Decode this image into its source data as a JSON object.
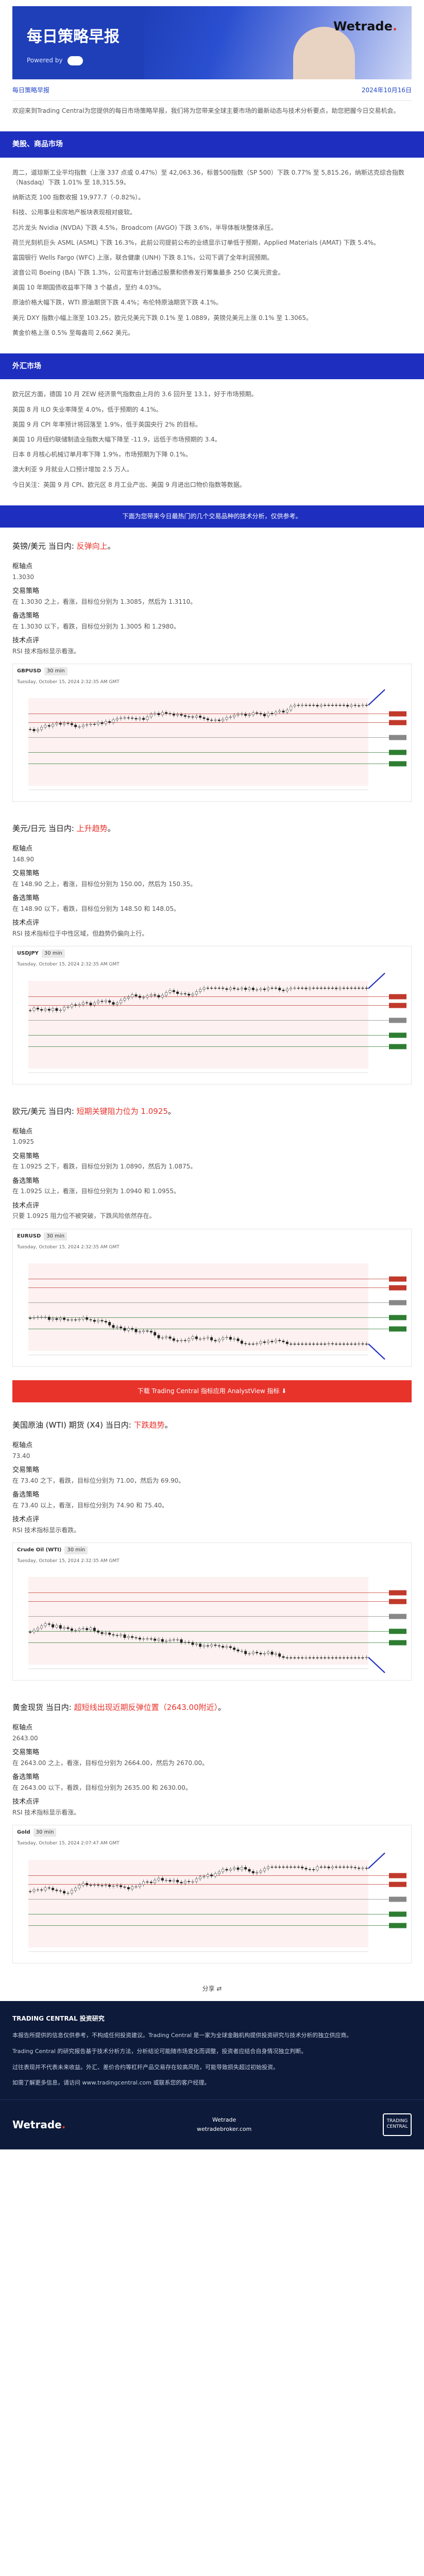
{
  "banner": {
    "title": "每日策略早报",
    "powered": "Powered by",
    "logo_main": "Wetrade",
    "logo_dot": "."
  },
  "meta": {
    "left": "每日策略早报",
    "right": "2024年10月16日"
  },
  "intro": "欢迎来到Trading Central为您提供的每日市场策略早报，我们将为您带来全球主要市场的最新动态与技术分析要点，助您把握今日交易机会。",
  "sections": {
    "stocks": "美股、商品市场",
    "fx": "外汇市场",
    "fx_intro_bar": "下面为您带来今日最热门的几个交易品种的技术分析，仅供参考。"
  },
  "stock_paras": [
    "周二，道琼斯工业平均指数（上涨 337 点或 0.47%）至 42,063.36，标普500指数（SP 500）下跌 0.77% 至 5,815.26，纳斯达克综合指数（Nasdaq）下跌 1.01% 至 18,315.59。",
    "纳斯达克 100 指数收报 19,977.7（-0.82%）。",
    "科技、公用事业和房地产板块表现相对疲软。",
    "芯片龙头 Nvidia (NVDA) 下跌 4.5%，Broadcom (AVGO) 下跌 3.6%，半导体板块整体承压。",
    "荷兰光刻机巨头 ASML (ASML) 下跌 16.3%，此前公司提前公布的业绩显示订单低于预期，Applied Materials (AMAT) 下跌 5.4%。",
    "富国银行 Wells Fargo (WFC) 上涨，联合健康 (UNH) 下跌 8.1%，公司下调了全年利润预期。",
    "波音公司 Boeing (BA) 下跌 1.3%，公司宣布计划通过股票和债券发行筹集最多 250 亿美元资金。",
    "美国 10 年期国债收益率下降 3 个基点，至约 4.03%。",
    "原油价格大幅下跌，WTI 原油期货下跌 4.4%；布伦特原油期货下跌 4.1%。",
    "美元 DXY 指数小幅上涨至 103.25，欧元兑美元下跌 0.1% 至 1.0889，英镑兑美元上涨 0.1% 至 1.3065。",
    "黄金价格上涨 0.5% 至每盎司 2,662 美元。"
  ],
  "fx_paras": [
    "欧元区方面，德国 10 月 ZEW 经济景气指数由上月的 3.6 回升至 13.1，好于市场预期。",
    "英国 8 月 ILO 失业率降至 4.0%，低于预期的 4.1%。",
    "英国 9 月 CPI 年率预计将回落至 1.9%，低于英国央行 2% 的目标。",
    "美国 10 月纽约联储制造业指数大幅下降至 -11.9，远低于市场预期的 3.4。",
    "日本 8 月核心机械订单月率下降 1.9%，市场预期为下降 0.1%。",
    "澳大利亚 9 月就业人口预计增加 2.5 万人。",
    "今日关注：英国 9 月 CPI、欧元区 8 月工业产出、美国 9 月进出口物价指数等数据。"
  ],
  "instruments": [
    {
      "name": "英镑/美元",
      "trend": "反弹向上",
      "pivot_label": "枢轴点",
      "pivot": "1.3030",
      "strategy_label": "交易策略",
      "strategy": "在 1.3030 之上，看涨，目标位分别为 1.3085，然后为 1.3110。",
      "alt_label": "备选策略",
      "alt": "在 1.3030 以下，看跌，目标位分别为 1.3005 和 1.2980。",
      "tech_label": "技术点评",
      "tech": "RSI 技术指标显示看涨。",
      "chart": {
        "symbol": "GBPUSD",
        "timeframe": "30 min",
        "sub": "Tuesday, October 15, 2024 2:32:35 AM GMT",
        "trend_dir": "up"
      }
    },
    {
      "name": "美元/日元",
      "trend": "上升趋势",
      "pivot_label": "枢轴点",
      "pivot": "148.90",
      "strategy_label": "交易策略",
      "strategy": "在 148.90 之上，看涨，目标位分别为 150.00，然后为 150.35。",
      "alt_label": "备选策略",
      "alt": "在 148.90 以下，看跌，目标位分别为 148.50 和 148.05。",
      "tech_label": "技术点评",
      "tech": "RSI 技术指标位于中性区域，但趋势仍偏向上行。",
      "chart": {
        "symbol": "USDJPY",
        "timeframe": "30 min",
        "sub": "Tuesday, October 15, 2024 2:32:35 AM GMT",
        "trend_dir": "up"
      }
    },
    {
      "name": "欧元/美元",
      "trend": "短期关键阻力位为 1.0925",
      "pivot_label": "枢轴点",
      "pivot": "1.0925",
      "strategy_label": "交易策略",
      "strategy": "在 1.0925 之下，看跌，目标位分别为 1.0890，然后为 1.0875。",
      "alt_label": "备选策略",
      "alt": "在 1.0925 以上，看涨，目标位分别为 1.0940 和 1.0955。",
      "tech_label": "技术点评",
      "tech": "只要 1.0925 阻力位不被突破，下跌风险依然存在。",
      "chart": {
        "symbol": "EURUSD",
        "timeframe": "30 min",
        "sub": "Tuesday, October 15, 2024 2:32:35 AM GMT",
        "trend_dir": "down"
      }
    }
  ],
  "cta": "下载 Trading Central 指标应用 AnalystView 指标 ⬇",
  "instruments2": [
    {
      "name": "美国原油 (WTI) 期货 (X4)",
      "trend": "下跌趋势",
      "pivot_label": "枢轴点",
      "pivot": "73.40",
      "strategy_label": "交易策略",
      "strategy": "在 73.40 之下，看跌，目标位分别为 71.00，然后为 69.90。",
      "alt_label": "备选策略",
      "alt": "在 73.40 以上，看涨，目标位分别为 74.90 和 75.40。",
      "tech_label": "技术点评",
      "tech": "RSI 技术指标显示看跌。",
      "chart": {
        "symbol": "Crude Oil (WTI)",
        "timeframe": "30 min",
        "sub": "Tuesday, October 15, 2024 2:32:35 AM GMT",
        "trend_dir": "down"
      }
    },
    {
      "name": "黄金现货",
      "trend": "超短线出现近期反弹位置（2643.00附近）",
      "pivot_label": "枢轴点",
      "pivot": "2643.00",
      "strategy_label": "交易策略",
      "strategy": "在 2643.00 之上，看涨，目标位分别为 2664.00，然后为 2670.00。",
      "alt_label": "备选策略",
      "alt": "在 2643.00 以下，看跌，目标位分别为 2635.00 和 2630.00。",
      "tech_label": "技术点评",
      "tech": "RSI 技术指标显示看涨。",
      "chart": {
        "symbol": "Gold",
        "timeframe": "30 min",
        "sub": "Tuesday, October 15, 2024 2:07:47 AM GMT",
        "trend_dir": "up"
      }
    }
  ],
  "share": "分享 ⇄",
  "footer": {
    "title": "TRADING CENTRAL 投资研究",
    "paras": [
      "本报告所提供的信息仅供参考，不构成任何投资建议。Trading Central 是一家为全球金融机构提供投资研究与技术分析的独立供应商。",
      "Trading Central 的研究报告基于技术分析方法，分析结论可能随市场变化而调整，投资者应结合自身情况独立判断。",
      "过往表现并不代表未来收益。外汇、差价合约等杠杆产品交易存在较高风险，可能导致损失超过初始投资。",
      "如需了解更多信息，请访问 www.tradingcentral.com 或联系您的客户经理。"
    ],
    "brand": "Wetrade",
    "brand_dot": ".",
    "site_name": "Wetrade",
    "site_url": "wetradebroker.com",
    "tc_logo": "TRADING CENTRAL"
  }
}
